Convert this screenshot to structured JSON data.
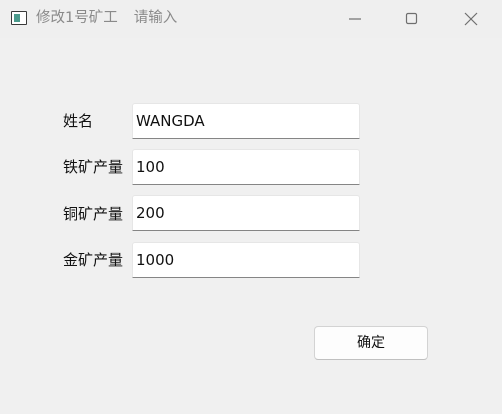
{
  "window": {
    "title": "修改1号矿工",
    "subtitle": "请输入"
  },
  "form": {
    "fields": [
      {
        "label": "姓名",
        "value": "WANGDA"
      },
      {
        "label": "铁矿产量",
        "value": "100"
      },
      {
        "label": "铜矿产量",
        "value": "200"
      },
      {
        "label": "金矿产量",
        "value": "1000"
      }
    ],
    "ok_label": "确定"
  },
  "icons": {
    "app": "window-app-icon",
    "minimize": "minimize-icon",
    "maximize": "maximize-icon",
    "close": "close-icon"
  }
}
